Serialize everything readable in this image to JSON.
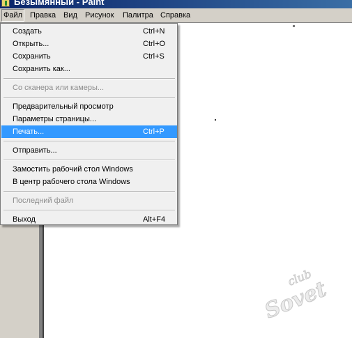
{
  "window": {
    "title": "Безымянный - Paint"
  },
  "menubar": {
    "items": [
      "Файл",
      "Правка",
      "Вид",
      "Рисунок",
      "Палитра",
      "Справка"
    ]
  },
  "file_menu": {
    "items": [
      {
        "label": "Создать",
        "shortcut": "Ctrl+N",
        "enabled": true
      },
      {
        "label": "Открыть...",
        "shortcut": "Ctrl+O",
        "enabled": true
      },
      {
        "label": "Сохранить",
        "shortcut": "Ctrl+S",
        "enabled": true
      },
      {
        "label": "Сохранить как...",
        "shortcut": "",
        "enabled": true
      },
      {
        "label": "Со сканера или камеры...",
        "shortcut": "",
        "enabled": false
      },
      {
        "label": "Предварительный просмотр",
        "shortcut": "",
        "enabled": true
      },
      {
        "label": "Параметры страницы...",
        "shortcut": "",
        "enabled": true
      },
      {
        "label": "Печать...",
        "shortcut": "Ctrl+P",
        "enabled": true,
        "highlighted": true
      },
      {
        "label": "Отправить...",
        "shortcut": "",
        "enabled": true
      },
      {
        "label": "Замостить рабочий стол Windows",
        "shortcut": "",
        "enabled": true
      },
      {
        "label": "В центр рабочего стола Windows",
        "shortcut": "",
        "enabled": true
      },
      {
        "label": "Последний файл",
        "shortcut": "",
        "enabled": false
      },
      {
        "label": "Выход",
        "shortcut": "Alt+F4",
        "enabled": true
      }
    ]
  },
  "watermark": {
    "line1": "club",
    "line2": "Sovet"
  },
  "colors": {
    "highlight": "#3399ff",
    "menu_bg": "#f0f0f0",
    "title_bar": "#0a246a",
    "disabled_text": "#8d8d8d"
  }
}
